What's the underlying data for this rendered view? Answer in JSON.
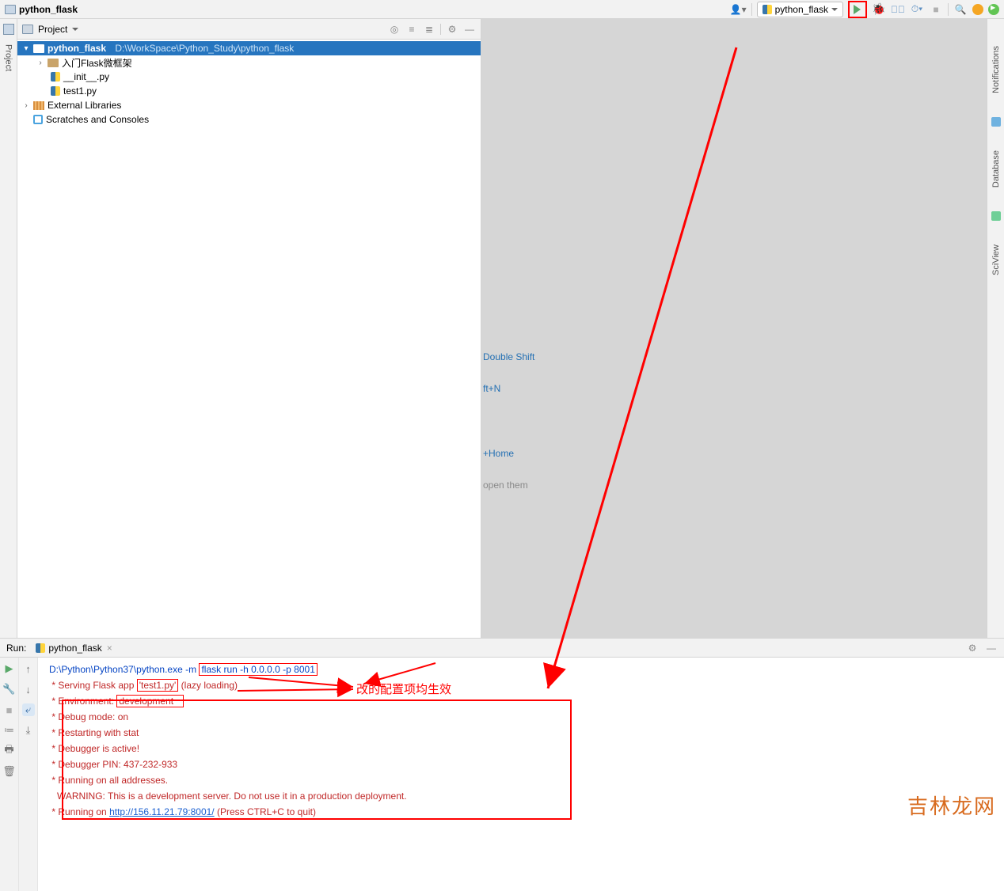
{
  "topbar": {
    "project_name": "python_flask",
    "config_name": "python_flask"
  },
  "left_rail": {
    "label": "Project"
  },
  "project_pane": {
    "title": "Project"
  },
  "tree": {
    "root_name": "python_flask",
    "root_path": "D:\\WorkSpace\\Python_Study\\python_flask",
    "child1": "入门Flask微框架",
    "file1": "__init__.py",
    "file2": "test1.py",
    "external": "External Libraries",
    "scratches": "Scratches and Consoles"
  },
  "editor_hints": {
    "l1": "Double Shift",
    "l2": "ft+N",
    "l3": "+Home",
    "l4": "open them"
  },
  "right_rail": {
    "t1": "Notifications",
    "t2": "Database",
    "t3": "SciView"
  },
  "run": {
    "label": "Run:",
    "tab": "python_flask",
    "cmd_prefix": "D:\\Python\\Python37\\python.exe -m ",
    "cmd_boxed": "flask run -h 0.0.0.0 -p 8001",
    "serving_pre": " * Serving Flask app ",
    "serving_box": "'test1.py'",
    "serving_post": " (lazy loading)",
    "env_pre": " * Environment: ",
    "env_box": "development",
    "debug_mode": " * Debug mode: on",
    "restart": " * Restarting with stat",
    "debugger_active": " * Debugger is active!",
    "pin": " * Debugger PIN: 437-232-933",
    "all_addr": " * Running on all addresses.",
    "warn": "   WARNING: This is a development server. Do not use it in a production deployment.",
    "running_pre": " * Running on ",
    "url": "http://156.11.21.79:8001/",
    "running_post": " (Press CTRL+C to quit)"
  },
  "annotation": "改的配置项均生效",
  "watermark": "吉林龙网"
}
